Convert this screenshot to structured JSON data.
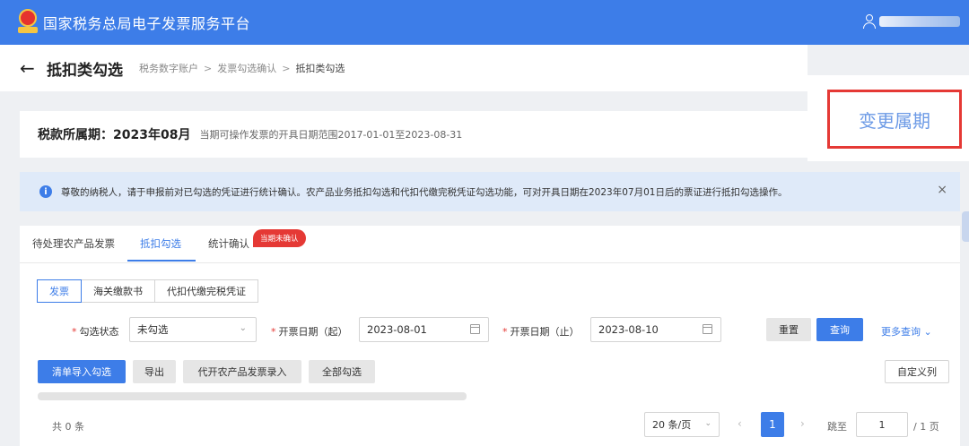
{
  "header": {
    "app_title": "国家税务总局电子发票服务平台"
  },
  "titlebar": {
    "title": "抵扣类勾选",
    "breadcrumb": [
      "税务数字账户",
      "发票勾选确认",
      "抵扣类勾选"
    ],
    "sep": ">"
  },
  "period": {
    "label": "税款所属期：2023年08月",
    "hint": "当期可操作发票的开具日期范围2017-01-01至2023-08-31"
  },
  "change_period_label": "变更属期",
  "notice": {
    "text": "尊敬的纳税人，请于申报前对已勾选的凭证进行统计确认。农产品业务抵扣勾选和代扣代缴完税凭证勾选功能，可对开具日期在2023年07月01日后的票证进行抵扣勾选操作。",
    "close": "×"
  },
  "tabs": [
    {
      "label": "待处理农产品发票"
    },
    {
      "label": "抵扣勾选"
    },
    {
      "label": "统计确认"
    }
  ],
  "tab_badge": "当期未确认",
  "subtabs": [
    {
      "label": "发票"
    },
    {
      "label": "海关缴款书"
    },
    {
      "label": "代扣代缴完税凭证"
    }
  ],
  "filters": {
    "status": {
      "label": "勾选状态",
      "value": "未勾选"
    },
    "start_date": {
      "label": "开票日期（起）",
      "value": "2023-08-01"
    },
    "end_date": {
      "label": "开票日期（止）",
      "value": "2023-08-10"
    }
  },
  "buttons": {
    "reset": "重置",
    "query": "查询",
    "more_query": "更多查询 ⌄",
    "import_select": "清单导入勾选",
    "export": "导出",
    "agri_entry": "代开农产品发票录入",
    "select_all": "全部勾选",
    "custom_cols": "自定义列"
  },
  "pagination": {
    "total": "共 0 条",
    "page_size": "20 条/页",
    "current_page": "1",
    "jump_label": "跳至",
    "jump_value": "1",
    "page_total": "/ 1 页"
  },
  "colors": {
    "brand": "#3d7de8",
    "highlight": "#e53935"
  }
}
